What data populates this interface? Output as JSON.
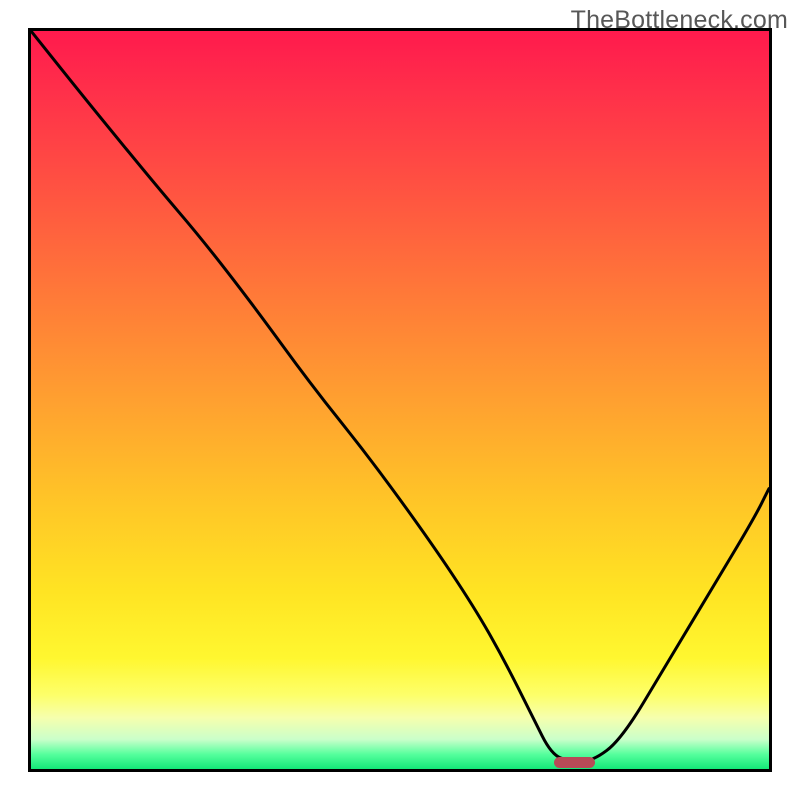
{
  "watermark": "TheBottleneck.com",
  "plot": {
    "inner_width": 738,
    "inner_height": 738
  },
  "chart_data": {
    "type": "line",
    "title": "",
    "xlabel": "",
    "ylabel": "",
    "xlim": [
      0,
      100
    ],
    "ylim": [
      0,
      100
    ],
    "legend": false,
    "grid": false,
    "background": "heatmap-gradient (red→green, top→bottom)",
    "series": [
      {
        "name": "bottleneck-curve",
        "x": [
          0,
          8,
          17,
          23,
          30,
          38,
          46,
          54,
          60,
          64,
          68,
          70.5,
          73,
          76,
          80,
          86,
          92,
          98,
          100
        ],
        "y": [
          100,
          90,
          79,
          72,
          63,
          52,
          42,
          31,
          22,
          15,
          7,
          2,
          1,
          1,
          4,
          14,
          24,
          34,
          38
        ]
      }
    ],
    "annotations": [
      {
        "name": "optimal-marker",
        "type": "bar-segment",
        "x_start": 70.8,
        "x_end": 76.4,
        "y": 0.5,
        "color": "#b84a57"
      }
    ]
  }
}
